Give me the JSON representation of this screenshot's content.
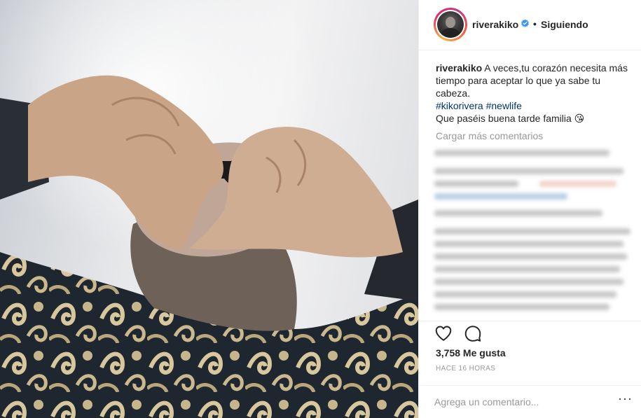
{
  "post": {
    "username": "riverakiko",
    "separator": "•",
    "follow_status": "Siguiendo",
    "caption": {
      "username": "riverakiko",
      "text": "A veces,tu corazón necesita más tiempo para aceptar lo que ya sabe tu cabeza.",
      "hashtags": "#kikorivera #newlife",
      "closing": "Que paséis buena tarde familia 😘"
    },
    "load_more": "Cargar más comentarios",
    "likes": "3,758 Me gusta",
    "timestamp": "HACE 16 HORAS",
    "comment_placeholder": "Agrega un comentario...",
    "more_label": "···"
  },
  "colors": {
    "verified": "#3897f0",
    "hashtag": "#003569",
    "muted": "#999999",
    "text": "#262626"
  },
  "icons": {
    "verified": "verified-badge-icon",
    "like": "heart-icon",
    "comment": "comment-bubble-icon",
    "more": "more-options-icon"
  }
}
